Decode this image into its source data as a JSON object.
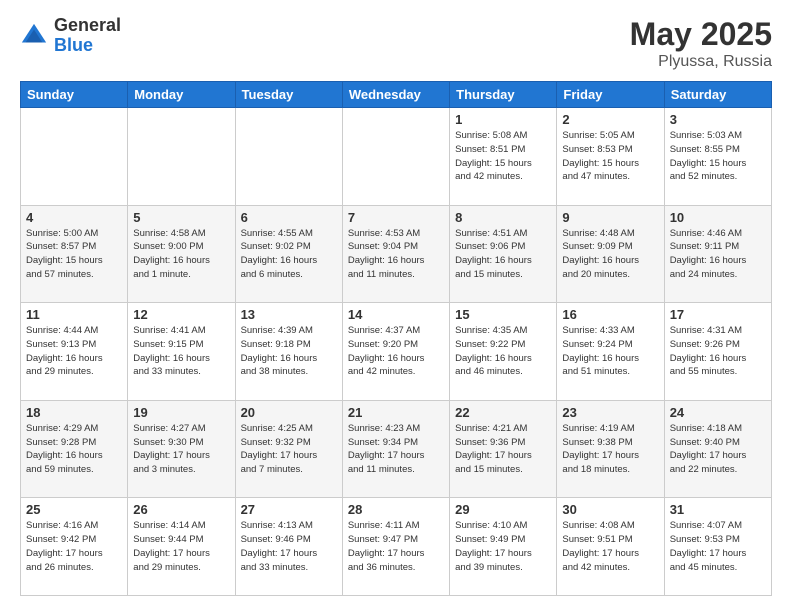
{
  "header": {
    "logo_general": "General",
    "logo_blue": "Blue",
    "title": "May 2025",
    "location": "Plyussa, Russia"
  },
  "days_of_week": [
    "Sunday",
    "Monday",
    "Tuesday",
    "Wednesday",
    "Thursday",
    "Friday",
    "Saturday"
  ],
  "weeks": [
    [
      {
        "day": "",
        "info": ""
      },
      {
        "day": "",
        "info": ""
      },
      {
        "day": "",
        "info": ""
      },
      {
        "day": "",
        "info": ""
      },
      {
        "day": "1",
        "info": "Sunrise: 5:08 AM\nSunset: 8:51 PM\nDaylight: 15 hours\nand 42 minutes."
      },
      {
        "day": "2",
        "info": "Sunrise: 5:05 AM\nSunset: 8:53 PM\nDaylight: 15 hours\nand 47 minutes."
      },
      {
        "day": "3",
        "info": "Sunrise: 5:03 AM\nSunset: 8:55 PM\nDaylight: 15 hours\nand 52 minutes."
      }
    ],
    [
      {
        "day": "4",
        "info": "Sunrise: 5:00 AM\nSunset: 8:57 PM\nDaylight: 15 hours\nand 57 minutes."
      },
      {
        "day": "5",
        "info": "Sunrise: 4:58 AM\nSunset: 9:00 PM\nDaylight: 16 hours\nand 1 minute."
      },
      {
        "day": "6",
        "info": "Sunrise: 4:55 AM\nSunset: 9:02 PM\nDaylight: 16 hours\nand 6 minutes."
      },
      {
        "day": "7",
        "info": "Sunrise: 4:53 AM\nSunset: 9:04 PM\nDaylight: 16 hours\nand 11 minutes."
      },
      {
        "day": "8",
        "info": "Sunrise: 4:51 AM\nSunset: 9:06 PM\nDaylight: 16 hours\nand 15 minutes."
      },
      {
        "day": "9",
        "info": "Sunrise: 4:48 AM\nSunset: 9:09 PM\nDaylight: 16 hours\nand 20 minutes."
      },
      {
        "day": "10",
        "info": "Sunrise: 4:46 AM\nSunset: 9:11 PM\nDaylight: 16 hours\nand 24 minutes."
      }
    ],
    [
      {
        "day": "11",
        "info": "Sunrise: 4:44 AM\nSunset: 9:13 PM\nDaylight: 16 hours\nand 29 minutes."
      },
      {
        "day": "12",
        "info": "Sunrise: 4:41 AM\nSunset: 9:15 PM\nDaylight: 16 hours\nand 33 minutes."
      },
      {
        "day": "13",
        "info": "Sunrise: 4:39 AM\nSunset: 9:18 PM\nDaylight: 16 hours\nand 38 minutes."
      },
      {
        "day": "14",
        "info": "Sunrise: 4:37 AM\nSunset: 9:20 PM\nDaylight: 16 hours\nand 42 minutes."
      },
      {
        "day": "15",
        "info": "Sunrise: 4:35 AM\nSunset: 9:22 PM\nDaylight: 16 hours\nand 46 minutes."
      },
      {
        "day": "16",
        "info": "Sunrise: 4:33 AM\nSunset: 9:24 PM\nDaylight: 16 hours\nand 51 minutes."
      },
      {
        "day": "17",
        "info": "Sunrise: 4:31 AM\nSunset: 9:26 PM\nDaylight: 16 hours\nand 55 minutes."
      }
    ],
    [
      {
        "day": "18",
        "info": "Sunrise: 4:29 AM\nSunset: 9:28 PM\nDaylight: 16 hours\nand 59 minutes."
      },
      {
        "day": "19",
        "info": "Sunrise: 4:27 AM\nSunset: 9:30 PM\nDaylight: 17 hours\nand 3 minutes."
      },
      {
        "day": "20",
        "info": "Sunrise: 4:25 AM\nSunset: 9:32 PM\nDaylight: 17 hours\nand 7 minutes."
      },
      {
        "day": "21",
        "info": "Sunrise: 4:23 AM\nSunset: 9:34 PM\nDaylight: 17 hours\nand 11 minutes."
      },
      {
        "day": "22",
        "info": "Sunrise: 4:21 AM\nSunset: 9:36 PM\nDaylight: 17 hours\nand 15 minutes."
      },
      {
        "day": "23",
        "info": "Sunrise: 4:19 AM\nSunset: 9:38 PM\nDaylight: 17 hours\nand 18 minutes."
      },
      {
        "day": "24",
        "info": "Sunrise: 4:18 AM\nSunset: 9:40 PM\nDaylight: 17 hours\nand 22 minutes."
      }
    ],
    [
      {
        "day": "25",
        "info": "Sunrise: 4:16 AM\nSunset: 9:42 PM\nDaylight: 17 hours\nand 26 minutes."
      },
      {
        "day": "26",
        "info": "Sunrise: 4:14 AM\nSunset: 9:44 PM\nDaylight: 17 hours\nand 29 minutes."
      },
      {
        "day": "27",
        "info": "Sunrise: 4:13 AM\nSunset: 9:46 PM\nDaylight: 17 hours\nand 33 minutes."
      },
      {
        "day": "28",
        "info": "Sunrise: 4:11 AM\nSunset: 9:47 PM\nDaylight: 17 hours\nand 36 minutes."
      },
      {
        "day": "29",
        "info": "Sunrise: 4:10 AM\nSunset: 9:49 PM\nDaylight: 17 hours\nand 39 minutes."
      },
      {
        "day": "30",
        "info": "Sunrise: 4:08 AM\nSunset: 9:51 PM\nDaylight: 17 hours\nand 42 minutes."
      },
      {
        "day": "31",
        "info": "Sunrise: 4:07 AM\nSunset: 9:53 PM\nDaylight: 17 hours\nand 45 minutes."
      }
    ]
  ]
}
